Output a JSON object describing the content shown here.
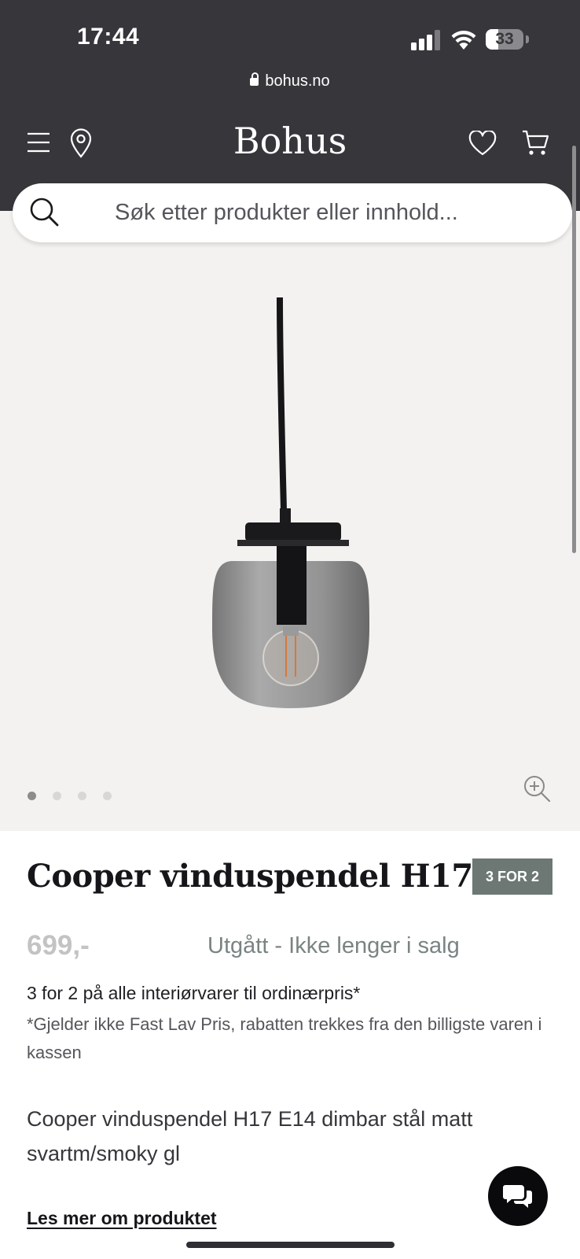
{
  "status_bar": {
    "time": "17:44",
    "battery": "33",
    "battery_level": 0.33
  },
  "browser": {
    "url": "bohus.no"
  },
  "header": {
    "logo": "Bohus"
  },
  "search": {
    "placeholder": "Søk etter produkter eller innhold..."
  },
  "gallery": {
    "image_count": 4,
    "active_index": 0
  },
  "product": {
    "title": "Cooper vinduspendel H17",
    "badge": "3 FOR 2",
    "price": "699,-",
    "status": "Utgått - Ikke lenger i salg",
    "promo": "3 for 2 på alle interiørvarer til ordinærpris*",
    "promo_note": "*Gjelder ikke Fast Lav Pris, rabatten trekkes fra den billigste varen i kassen",
    "description": "Cooper vinduspendel H17 E14 dimbar stål matt svartm/smoky gl",
    "read_more": "Les mer om produktet"
  },
  "colors": {
    "header_bg": "#36363b",
    "badge_bg": "#6d7875",
    "gallery_bg": "#f3f2f0"
  },
  "icons": [
    "menu-icon",
    "location-pin-icon",
    "heart-icon",
    "cart-icon",
    "search-icon",
    "zoom-in-icon",
    "chat-icon",
    "lock-icon"
  ]
}
